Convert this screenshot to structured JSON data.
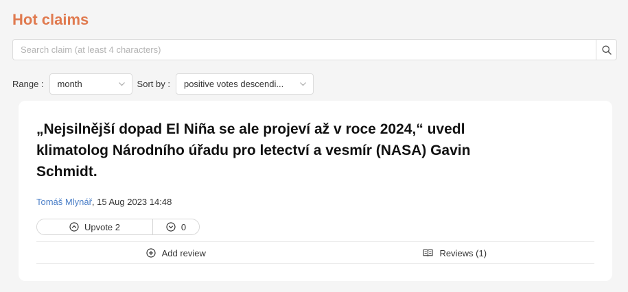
{
  "header": {
    "title": "Hot claims"
  },
  "search": {
    "placeholder": "Search claim (at least 4 characters)",
    "icon": "search-icon"
  },
  "filters": {
    "range_label": "Range :",
    "range_value": "month",
    "sort_label": "Sort by :",
    "sort_value": "positive votes descendi..."
  },
  "claim": {
    "text": "„Nejsilnější dopad El Niña se ale projeví až v roce 2024,“ uvedl klimatolog Národního úřadu pro letectví a vesmír (NASA) Gavin Schmidt.",
    "author": "Tomáš Mlynář",
    "date": ", 15 Aug 2023 14:48",
    "upvote_label": "Upvote 2",
    "downvote_count": "0",
    "add_review_label": "Add review",
    "reviews_label": "Reviews (1)"
  },
  "colors": {
    "title": "#e07a4f",
    "link": "#4a7ec7",
    "background": "#f5f5f5"
  }
}
